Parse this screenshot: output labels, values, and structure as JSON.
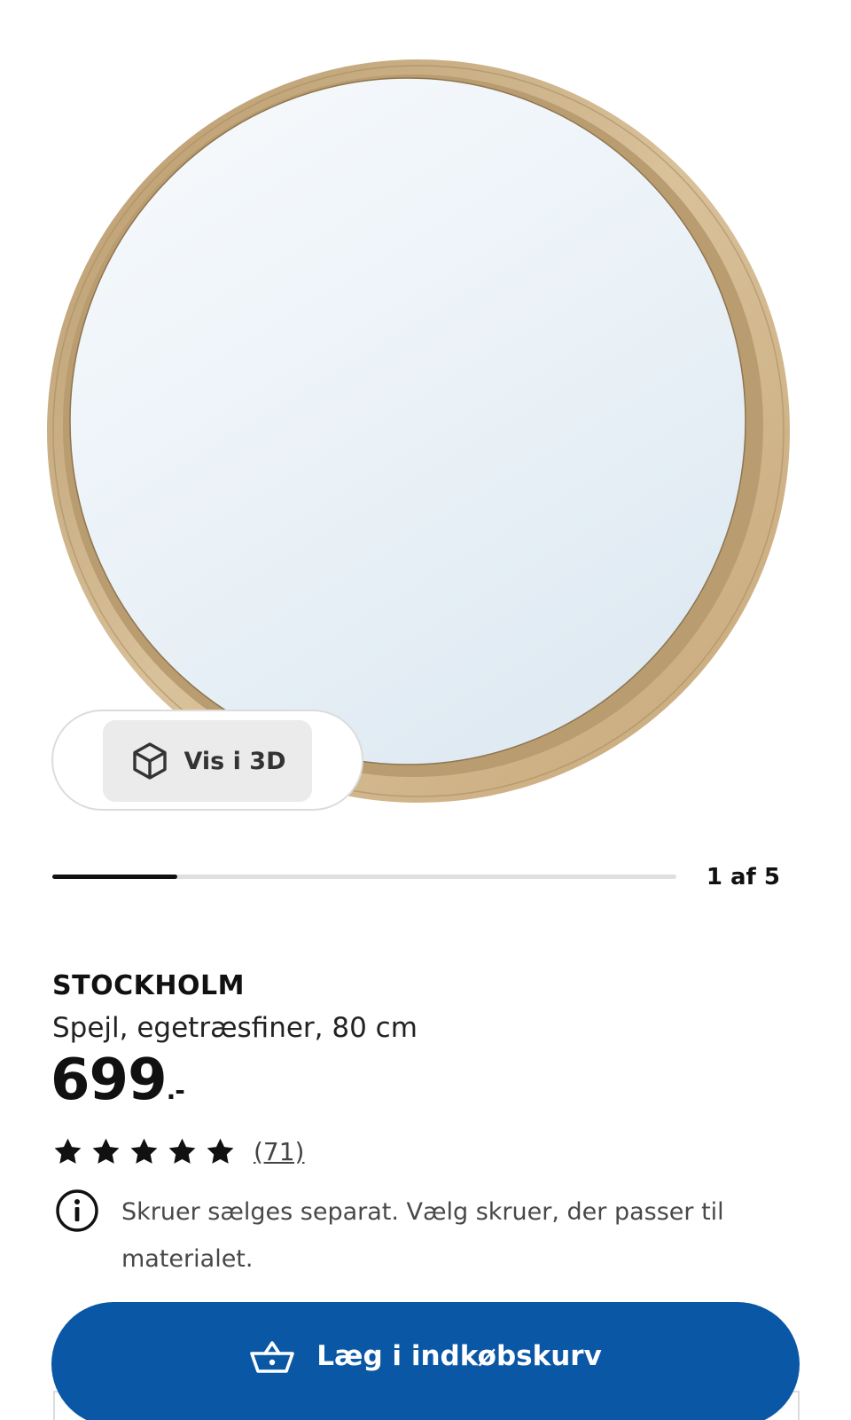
{
  "gallery": {
    "image": "stockholm-mirror",
    "view_3d_label": "Vis i 3D",
    "counter": "1 af 5",
    "current_index": 1,
    "total_images": 5
  },
  "product": {
    "brand": "STOCKHOLM",
    "description": "Spejl, egetræsfiner, 80 cm",
    "price": "699",
    "price_suffix": ".-",
    "rating_stars": 5,
    "review_count": "(71)"
  },
  "notice": {
    "icon": "info-icon",
    "text": "Skruer sælges separat. Vælg skruer, der passer til materialet."
  },
  "cta": {
    "icon": "basket-icon",
    "label": "Læg i indkøbskurv"
  },
  "colors": {
    "cta_background": "#0a57a6",
    "frame": "#c8ab7d",
    "glass": "#eef4f9",
    "progress_active": "#111111",
    "progress_track": "#dfdfdf"
  }
}
